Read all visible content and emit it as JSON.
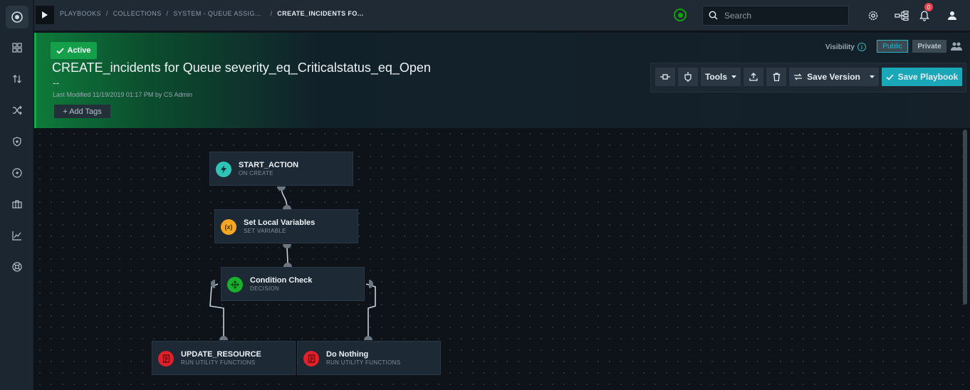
{
  "breadcrumbs": [
    "PLAYBOOKS",
    "COLLECTIONS",
    "SYSTEM - QUEUE ASSIG..."
  ],
  "breadcrumb_current": "CREATE_INCIDENTS FO...",
  "breadcrumb_sep": "/",
  "search": {
    "placeholder": "Search"
  },
  "notifications": {
    "count": "0"
  },
  "playbook": {
    "status": "Active",
    "title": "CREATE_incidents for Queue severity_eq_Criticalstatus_eq_Open",
    "description": "--",
    "last_modified": "Last Modified 11/19/2019 01:17 PM by CS Admin",
    "add_tags": "+ Add Tags"
  },
  "visibility": {
    "label": "Visibility",
    "info": "i",
    "public": "Public",
    "private": "Private"
  },
  "toolbar": {
    "tools": "Tools",
    "save_version": "Save Version",
    "save_playbook": "Save Playbook"
  },
  "nodes": [
    {
      "name": "START_ACTION",
      "type": "ON CREATE",
      "icon": "bolt-icon",
      "color": "#2ec4b6"
    },
    {
      "name": "Set Local Variables",
      "type": "SET VARIABLE",
      "icon": "variable-icon",
      "color": "#f5a623",
      "glyph": "(x)"
    },
    {
      "name": "Condition Check",
      "type": "DECISION",
      "icon": "decision-icon",
      "color": "#19b02b"
    },
    {
      "name": "UPDATE_RESOURCE",
      "type": "RUN UTILITY FUNCTIONS",
      "icon": "utility-icon",
      "color": "#e0202a"
    },
    {
      "name": "Do Nothing",
      "type": "RUN UTILITY FUNCTIONS",
      "icon": "utility-icon",
      "color": "#e0202a"
    }
  ],
  "colors": {
    "accent": "#1aa8b8",
    "active": "#14a04b",
    "danger": "#e0202a"
  }
}
